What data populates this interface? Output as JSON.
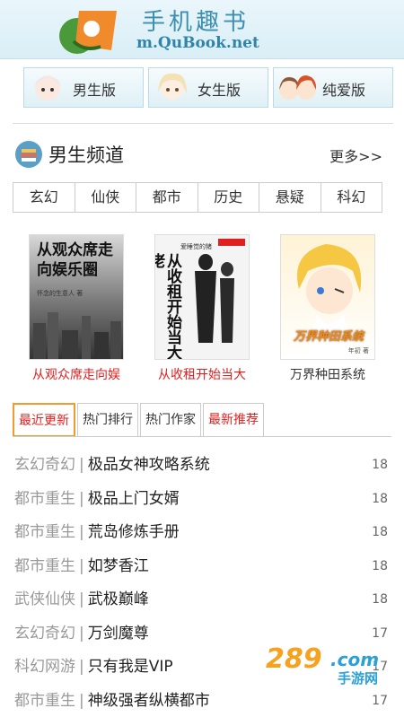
{
  "header": {
    "site_name": "手机趣书",
    "site_url": "m.QuBook.net"
  },
  "versions": [
    {
      "label": "男生版",
      "avatar_icon": "boy-avatar-icon"
    },
    {
      "label": "女生版",
      "avatar_icon": "girl-avatar-icon"
    },
    {
      "label": "纯爱版",
      "avatar_icon": "couple-avatar-icon"
    }
  ],
  "channel": {
    "title": "男生频道",
    "more": "更多>>"
  },
  "categories": [
    "玄幻",
    "仙侠",
    "都市",
    "历史",
    "悬疑",
    "科幻"
  ],
  "books": [
    {
      "title": "从观众席走向娱",
      "cover_text": "从观众席走向娱乐圈",
      "cover_author": "怀念的生意人 著",
      "title_color": "#e02020"
    },
    {
      "title": "从收租开始当大",
      "cover_text": "从收租开始当大佬",
      "cover_author": "爱睡觉的猪",
      "title_color": "#e02020"
    },
    {
      "title": "万界种田系统",
      "cover_text": "万界种田系统",
      "cover_author": "年初 著",
      "title_color": "#333333"
    }
  ],
  "tabs": [
    "最近更新",
    "热门排行",
    "热门作家",
    "最新推荐"
  ],
  "list": [
    {
      "genre": "玄幻奇幻",
      "title": "极品女神攻略系统",
      "num": "18"
    },
    {
      "genre": "都市重生",
      "title": "极品上门女婿",
      "num": "18"
    },
    {
      "genre": "都市重生",
      "title": "荒岛修炼手册",
      "num": "18"
    },
    {
      "genre": "都市重生",
      "title": "如梦香江",
      "num": "18"
    },
    {
      "genre": "武侠仙侠",
      "title": "武极巅峰",
      "num": "18"
    },
    {
      "genre": "玄幻奇幻",
      "title": "万剑魔尊",
      "num": "17"
    },
    {
      "genre": "科幻网游",
      "title": "只有我是VIP",
      "num": "17"
    },
    {
      "genre": "都市重生",
      "title": "神级强者纵横都市",
      "num": "17"
    }
  ],
  "watermark": {
    "brand": "289",
    "sub": "手游网",
    "suffix": ".com"
  },
  "colors": {
    "accent_red": "#e02020",
    "tab_border": "#f39a2e",
    "brand_blue": "#3d8fb0"
  }
}
